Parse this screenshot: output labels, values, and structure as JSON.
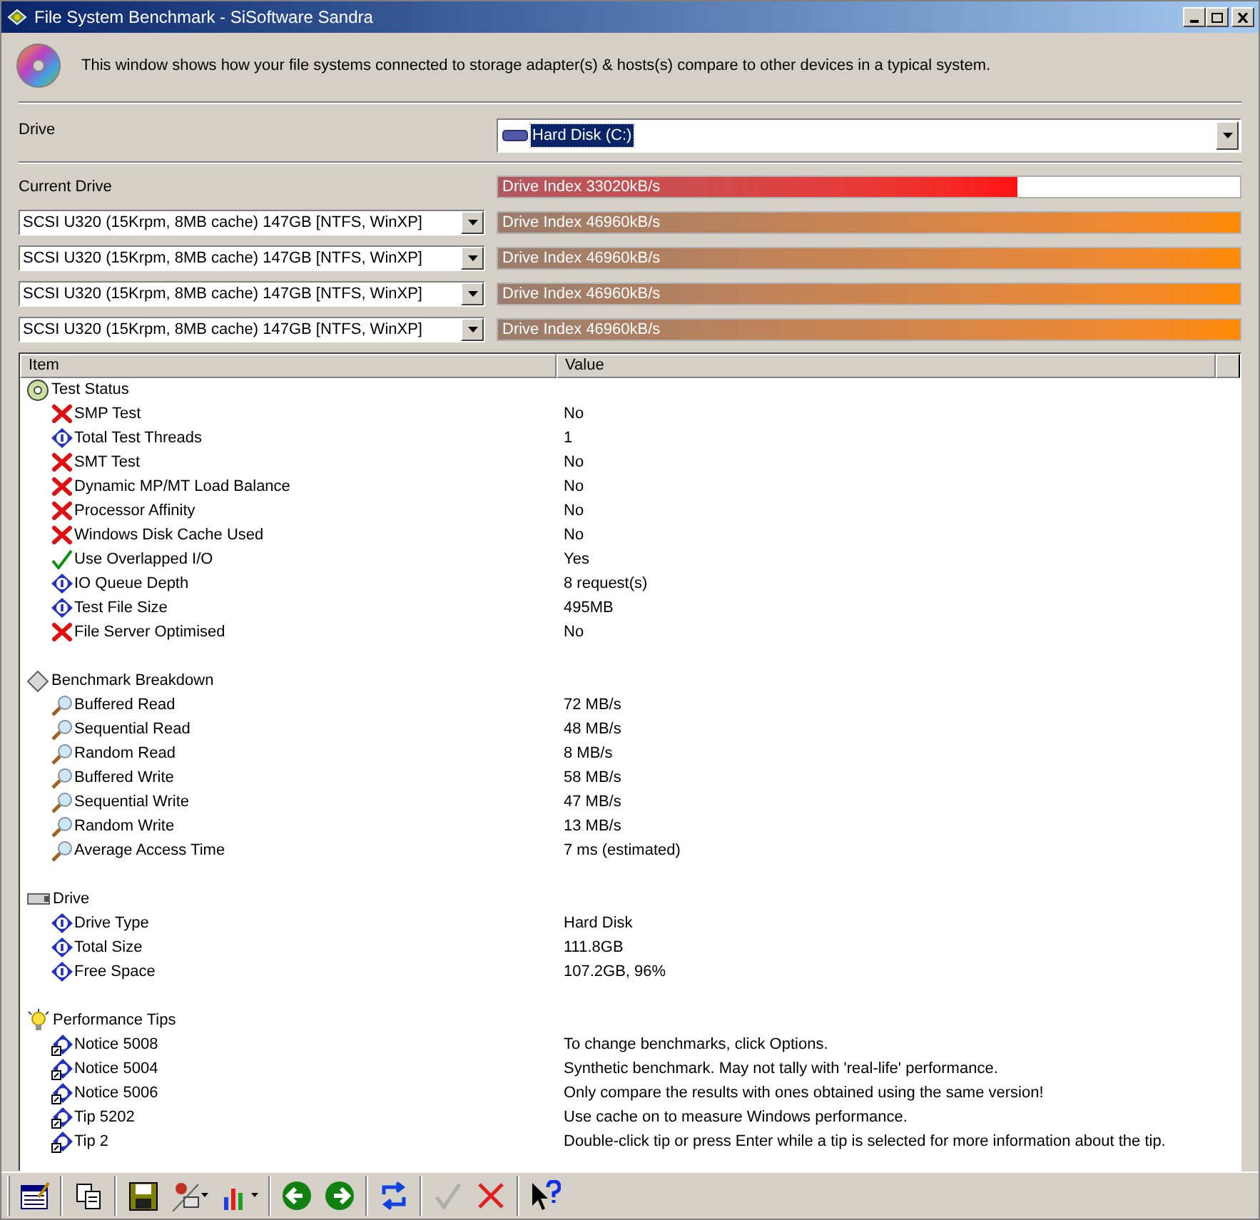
{
  "window": {
    "title": "File System Benchmark - SiSoftware Sandra"
  },
  "description": "This window shows how your file systems connected to storage adapter(s) & hosts(s) compare to other devices in a typical system.",
  "drive": {
    "label": "Drive",
    "value": "Hard Disk (C:)"
  },
  "comparison": {
    "label": "Current Drive",
    "current": {
      "reading": "Drive Index 33020kB/s",
      "level": 0.7
    },
    "references": [
      {
        "device": "SCSI U320 (15Krpm, 8MB cache) 147GB [NTFS, WinXP]",
        "reading": "Drive Index 46960kB/s",
        "level": 1
      },
      {
        "device": "SCSI U320 (15Krpm, 8MB cache) 147GB [NTFS, WinXP]",
        "reading": "Drive Index 46960kB/s",
        "level": 1
      },
      {
        "device": "SCSI U320 (15Krpm, 8MB cache) 147GB [NTFS, WinXP]",
        "reading": "Drive Index 46960kB/s",
        "level": 1
      },
      {
        "device": "SCSI U320 (15Krpm, 8MB cache) 147GB [NTFS, WinXP]",
        "reading": "Drive Index 46960kB/s",
        "level": 1
      }
    ]
  },
  "table": {
    "columns": [
      "Item",
      "Value"
    ],
    "groups": [
      {
        "title": "Test Status",
        "kind": "disc",
        "children": [
          {
            "item": "SMP Test",
            "value": "No",
            "kind": "no"
          },
          {
            "item": "Total Test Threads",
            "value": "1",
            "kind": "info"
          },
          {
            "item": "SMT Test",
            "value": "No",
            "kind": "no"
          },
          {
            "item": "Dynamic MP/MT Load Balance",
            "value": "No",
            "kind": "no"
          },
          {
            "item": "Processor Affinity",
            "value": "No",
            "kind": "no"
          },
          {
            "item": "Windows Disk Cache Used",
            "value": "No",
            "kind": "no"
          },
          {
            "item": "Use Overlapped I/O",
            "value": "Yes",
            "kind": "yes"
          },
          {
            "item": "IO Queue Depth",
            "value": "8 request(s)",
            "kind": "info"
          },
          {
            "item": "Test File Size",
            "value": "495MB",
            "kind": "info"
          },
          {
            "item": "File Server Optimised",
            "value": "No",
            "kind": "no"
          }
        ]
      },
      {
        "title": "Benchmark Breakdown",
        "kind": "diamond",
        "children": [
          {
            "item": "Buffered Read",
            "value": "72 MB/s",
            "kind": "test"
          },
          {
            "item": "Sequential Read",
            "value": "48 MB/s",
            "kind": "test"
          },
          {
            "item": "Random Read",
            "value": "8 MB/s",
            "kind": "test"
          },
          {
            "item": "Buffered Write",
            "value": "58 MB/s",
            "kind": "test"
          },
          {
            "item": "Sequential Write",
            "value": "47 MB/s",
            "kind": "test"
          },
          {
            "item": "Random Write",
            "value": "13 MB/s",
            "kind": "test"
          },
          {
            "item": "Average Access Time",
            "value": "7 ms (estimated)",
            "kind": "test"
          }
        ]
      },
      {
        "title": "Drive",
        "kind": "drive",
        "children": [
          {
            "item": "Drive Type",
            "value": "Hard Disk",
            "kind": "info"
          },
          {
            "item": "Total Size",
            "value": "111.8GB",
            "kind": "info"
          },
          {
            "item": "Free Space",
            "value": "107.2GB, 96%",
            "kind": "info"
          }
        ]
      },
      {
        "title": "Performance Tips",
        "kind": "bulb",
        "children": [
          {
            "item": "Notice 5008",
            "value": "To change benchmarks, click Options.",
            "kind": "tip"
          },
          {
            "item": "Notice 5004",
            "value": "Synthetic benchmark. May not tally with 'real-life' performance.",
            "kind": "tip"
          },
          {
            "item": "Notice 5006",
            "value": "Only compare the results with ones obtained using the same version!",
            "kind": "tip"
          },
          {
            "item": "Tip 5202",
            "value": "Use cache on to measure Windows performance.",
            "kind": "tip"
          },
          {
            "item": "Tip 2",
            "value": "Double-click tip or press Enter while a tip is selected for more information about the tip.",
            "kind": "tip"
          }
        ]
      }
    ]
  },
  "toolbar": [
    {
      "kind": "report",
      "disabled": false
    },
    {
      "kind": "copy",
      "disabled": false
    },
    {
      "kind": "save",
      "disabled": false
    },
    {
      "kind": "user",
      "disabled": false
    },
    {
      "kind": "chart",
      "disabled": false
    },
    {
      "kind": "back",
      "disabled": false
    },
    {
      "kind": "forward",
      "disabled": false
    },
    {
      "kind": "refresh",
      "disabled": false
    },
    {
      "kind": "ok",
      "disabled": true
    },
    {
      "kind": "cancel",
      "disabled": false
    },
    {
      "kind": "help",
      "disabled": false
    }
  ]
}
